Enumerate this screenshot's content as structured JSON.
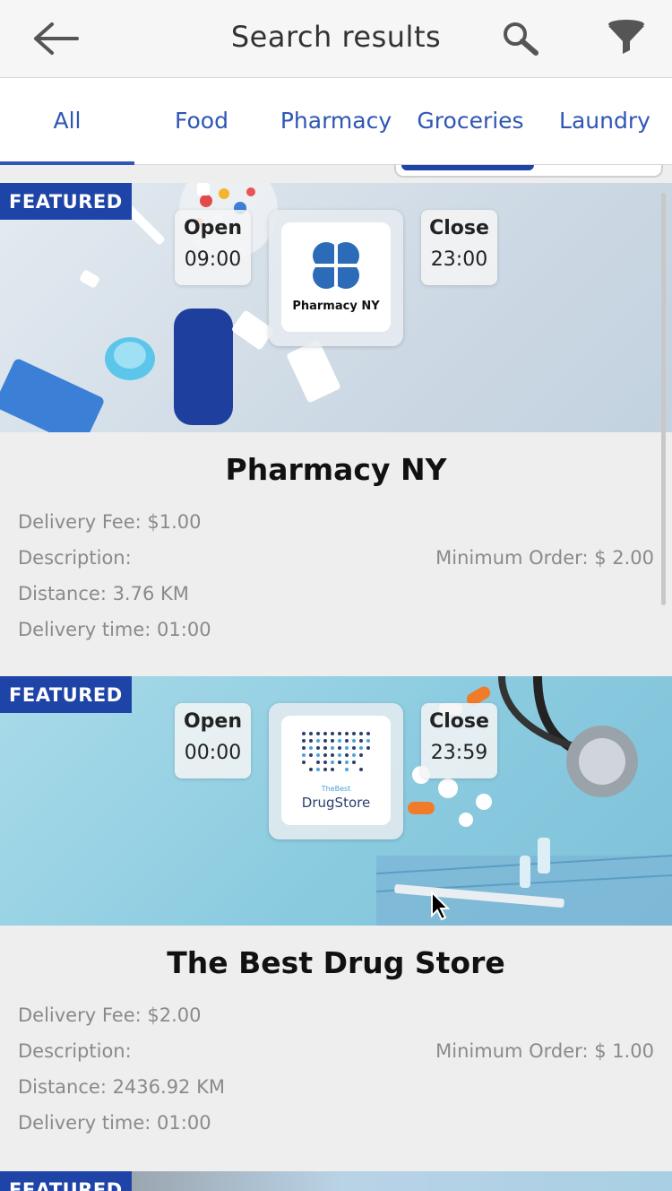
{
  "header": {
    "title": "Search results",
    "back_icon": "arrow-left-icon",
    "search_icon": "search-icon",
    "filter_icon": "filter-icon"
  },
  "tabs": [
    {
      "label": "All",
      "active": true
    },
    {
      "label": "Food",
      "active": false
    },
    {
      "label": "Pharmacy",
      "active": false
    },
    {
      "label": "Groceries",
      "active": false
    },
    {
      "label": "Laundry",
      "active": false
    }
  ],
  "stores": [
    {
      "badge": "FEATURED",
      "open_label": "Open",
      "open_time": "09:00",
      "close_label": "Close",
      "close_time": "23:00",
      "logo_text": "Pharmacy NY",
      "name": "Pharmacy NY",
      "delivery_fee": "Delivery Fee: $1.00",
      "description": "Description:",
      "minimum_order": "Minimum Order: $ 2.00",
      "distance": "Distance: 3.76 KM",
      "delivery_time": "Delivery time: 01:00"
    },
    {
      "badge": "FEATURED",
      "open_label": "Open",
      "open_time": "00:00",
      "close_label": "Close",
      "close_time": "23:59",
      "logo_text_small": "TheBest",
      "logo_text": "DrugStore",
      "name": "The Best Drug Store",
      "delivery_fee": "Delivery Fee: $2.00",
      "description": "Description:",
      "minimum_order": "Minimum Order: $ 1.00",
      "distance": "Distance: 2436.92 KM",
      "delivery_time": "Delivery time: 01:00"
    },
    {
      "badge": "FEATURED"
    }
  ],
  "colors": {
    "accent": "#1f44a8",
    "tab_text": "#2f56b5",
    "muted_text": "#8a8a8a"
  }
}
